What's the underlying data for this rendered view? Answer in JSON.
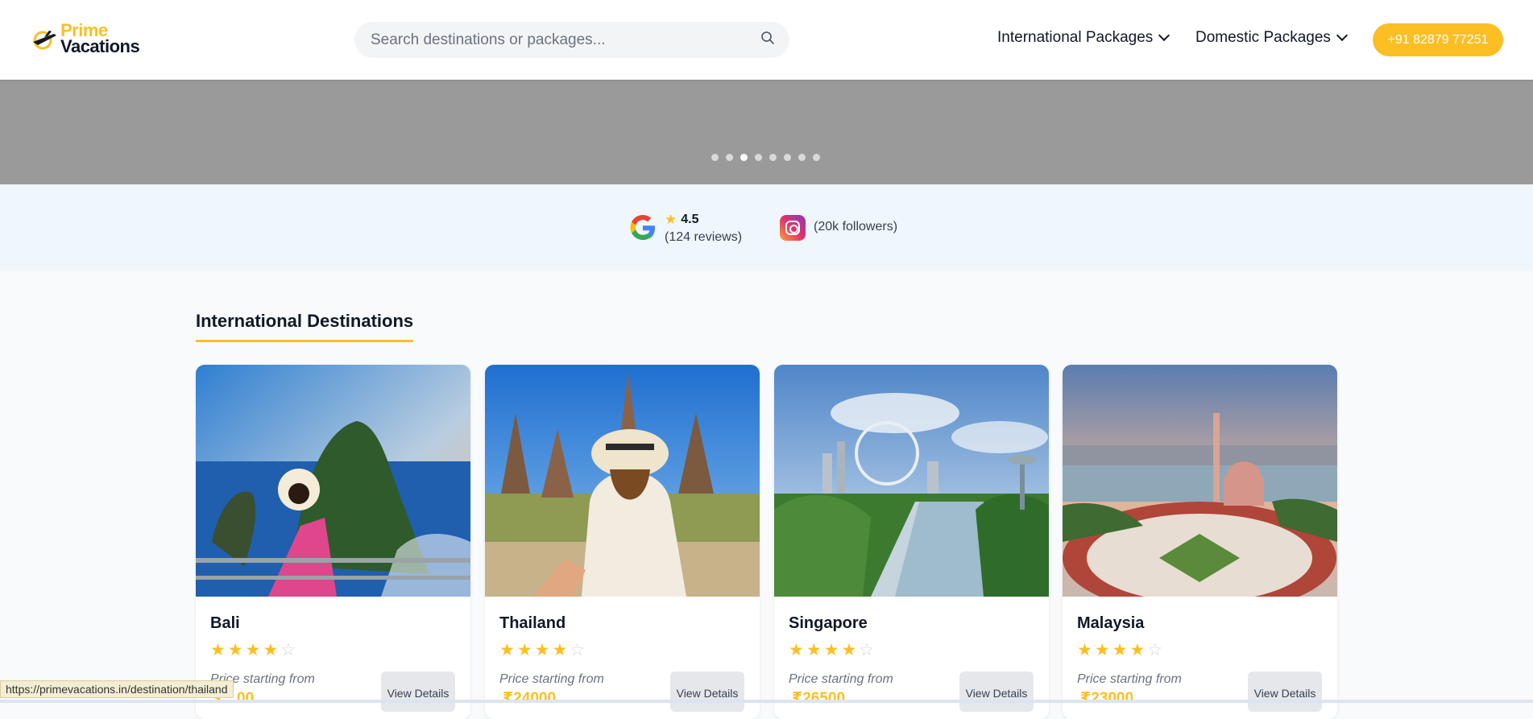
{
  "header": {
    "logo_line1": "Prime",
    "logo_line2": "Vacations",
    "search_placeholder": "Search destinations or packages...",
    "nav": [
      "International Packages",
      "Domestic Packages"
    ],
    "phone": "+91 82879 77251"
  },
  "hero": {
    "slide_count": 8,
    "active_slide": 3
  },
  "reviews": {
    "rating": "4.5",
    "reviews_count": "(124 reviews)",
    "followers": "(20k followers)"
  },
  "section": {
    "title": "International Destinations"
  },
  "cards": [
    {
      "name": "Bali",
      "rating": 4,
      "price_label": "Price starting from",
      "price": "₹...00",
      "button": "View Details"
    },
    {
      "name": "Thailand",
      "rating": 4,
      "price_label": "Price starting from",
      "price": "₹24000",
      "button": "View Details"
    },
    {
      "name": "Singapore",
      "rating": 4,
      "price_label": "Price starting from",
      "price": "₹26500",
      "button": "View Details"
    },
    {
      "name": "Malaysia",
      "rating": 4,
      "price_label": "Price starting from",
      "price": "₹23000",
      "button": "View Details"
    }
  ],
  "status_bar": "https://primevacations.in/destination/thailand",
  "colors": {
    "accent": "#fbbf24",
    "hero": "#9a9a9a",
    "reviews_bg": "#eff6fc"
  }
}
